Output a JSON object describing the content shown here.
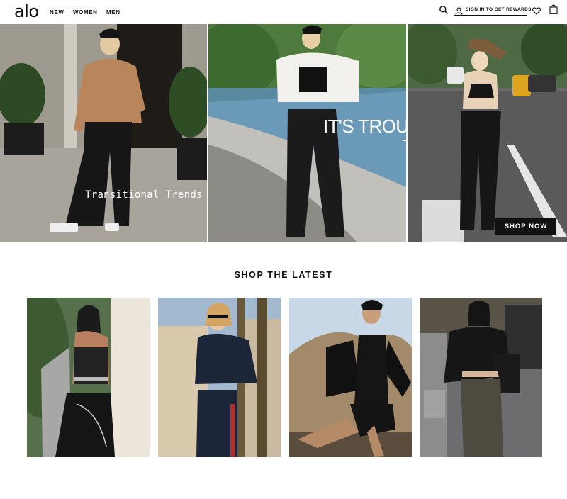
{
  "header": {
    "logo": "alo",
    "nav": [
      "NEW",
      "WOMEN",
      "MEN"
    ],
    "sign_in_label": "SIGN IN TO GET REWARDS",
    "icons": [
      "search-icon",
      "user-icon",
      "heart-icon",
      "shopping-bag-icon"
    ]
  },
  "hero": {
    "panel1_caption": "Transitional Trends",
    "panel2_headline": [
      "IT'S TROUSER",
      "TIME"
    ],
    "cta_label": "SHOP NOW"
  },
  "section": {
    "title": "SHOP THE LATEST"
  },
  "colors": {
    "text": "#111111",
    "background": "#ffffff",
    "cta_background": "#111111",
    "cta_text": "#ffffff"
  }
}
